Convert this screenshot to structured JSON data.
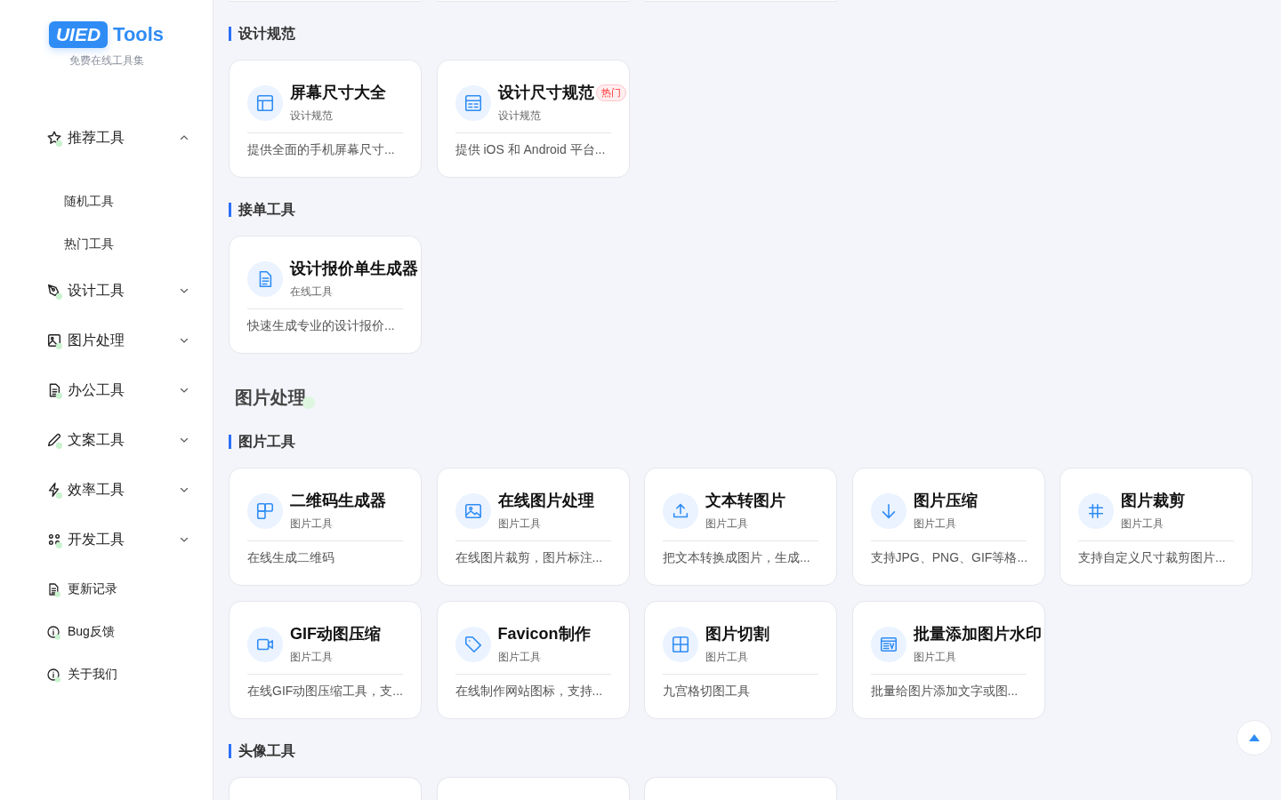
{
  "sidebar": {
    "logo": {
      "badge": "UIED",
      "text": "Tools",
      "subtitle": "免费在线工具集"
    },
    "menu": [
      {
        "label": "推荐工具",
        "kind": "star",
        "expanded": true,
        "children": [
          {
            "label": "随机工具"
          },
          {
            "label": "热门工具"
          }
        ]
      },
      {
        "label": "设计工具",
        "kind": "pen",
        "expanded": false
      },
      {
        "label": "图片处理",
        "kind": "image",
        "expanded": false
      },
      {
        "label": "办公工具",
        "kind": "doc",
        "expanded": false
      },
      {
        "label": "文案工具",
        "kind": "pencil",
        "expanded": false
      },
      {
        "label": "效率工具",
        "kind": "bolt",
        "expanded": false
      },
      {
        "label": "开发工具",
        "kind": "grid",
        "expanded": false
      }
    ],
    "links": [
      {
        "label": "更新记录",
        "kind": "doc"
      },
      {
        "label": "Bug反馈",
        "kind": "info"
      },
      {
        "label": "关于我们",
        "kind": "info"
      }
    ]
  },
  "main": {
    "sections": [
      {
        "kind": "cut-top",
        "cards": [
          {
            "kind": "cut"
          },
          {
            "kind": "cut"
          },
          {
            "kind": "cut"
          }
        ]
      },
      {
        "kind": "group",
        "title": "设计规范",
        "cards": [
          {
            "kind": "layout",
            "title": "屏幕尺寸大全",
            "category": "设计规范",
            "description": "提供全面的手机屏幕尺寸..."
          },
          {
            "kind": "table",
            "title": "设计尺寸规范",
            "badge": "热门",
            "category": "设计规范",
            "description": "提供 iOS 和 Android 平台..."
          }
        ]
      },
      {
        "kind": "group",
        "title": "接单工具",
        "cards": [
          {
            "kind": "doc",
            "title": "设计报价单生成器",
            "category": "在线工具",
            "description": "快速生成专业的设计报价..."
          }
        ]
      },
      {
        "kind": "category",
        "title": "图片处理"
      },
      {
        "kind": "group",
        "title": "图片工具",
        "cards": [
          {
            "kind": "qr",
            "title": "二维码生成器",
            "category": "图片工具",
            "description": "在线生成二维码"
          },
          {
            "kind": "image",
            "title": "在线图片处理",
            "category": "图片工具",
            "description": "在线图片裁剪，图片标注..."
          },
          {
            "kind": "upload",
            "title": "文本转图片",
            "category": "图片工具",
            "description": "把文本转换成图片，生成..."
          },
          {
            "kind": "download",
            "title": "图片压缩",
            "category": "图片工具",
            "description": "支持JPG、PNG、GIF等格..."
          },
          {
            "kind": "crop",
            "title": "图片裁剪",
            "category": "图片工具",
            "description": "支持自定义尺寸裁剪图片..."
          },
          {
            "kind": "video",
            "title": "GIF动图压缩",
            "category": "图片工具",
            "description": "在线GIF动图压缩工具，支..."
          },
          {
            "kind": "tag",
            "title": "Favicon制作",
            "category": "图片工具",
            "description": "在线制作网站图标，支持..."
          },
          {
            "kind": "grid4",
            "title": "图片切割",
            "category": "图片工具",
            "description": "九宫格切图工具"
          },
          {
            "kind": "watermark",
            "title": "批量添加图片水印",
            "category": "图片工具",
            "description": "批量给图片添加文字或图..."
          }
        ]
      },
      {
        "kind": "group",
        "title": "头像工具",
        "cards": [
          {
            "kind": "cut"
          },
          {
            "kind": "cut"
          },
          {
            "kind": "cut"
          }
        ]
      }
    ]
  }
}
